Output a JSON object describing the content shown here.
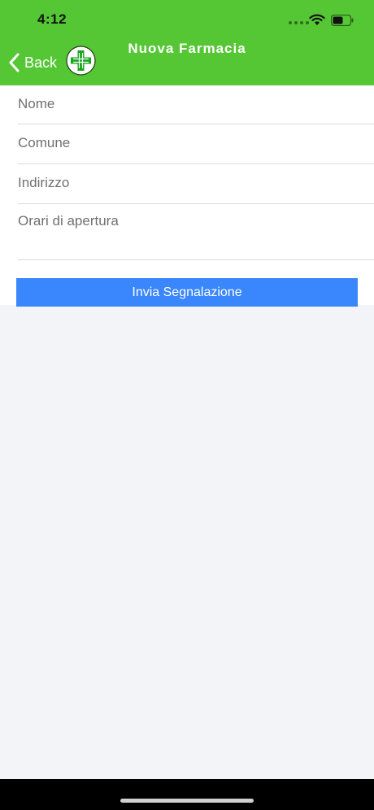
{
  "status_bar": {
    "time": "4:12",
    "icons": [
      "signal-dots-icon",
      "wifi-icon",
      "battery-icon"
    ]
  },
  "nav": {
    "back_label": "Back",
    "back_icon": "chevron-left-icon",
    "logo_icon": "pharmacy-cross-icon",
    "title": "Nuova Farmacia"
  },
  "form": {
    "nome": {
      "placeholder": "Nome",
      "value": ""
    },
    "comune": {
      "placeholder": "Comune",
      "value": ""
    },
    "indirizzo": {
      "placeholder": "Indirizzo",
      "value": ""
    },
    "orari": {
      "placeholder": "Orari di apertura",
      "value": ""
    },
    "submit_label": "Invia Segnalazione"
  },
  "colors": {
    "header": "#55c634",
    "submit": "#3a86fd",
    "background": "#f2f4f8",
    "logo_cross": "#17a51d"
  }
}
